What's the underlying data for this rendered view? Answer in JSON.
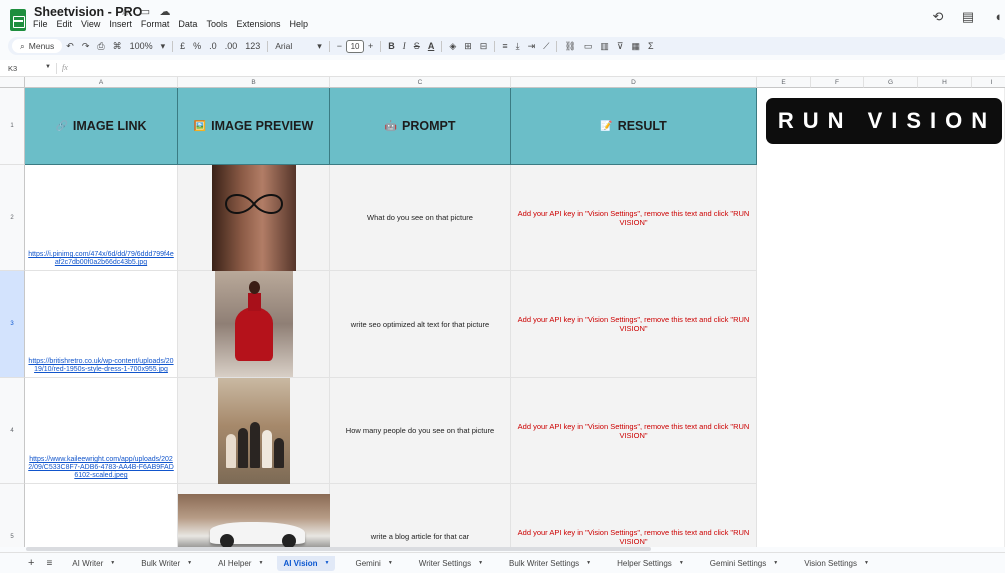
{
  "app": {
    "title": "Sheetvision - PRO",
    "menus": [
      "File",
      "Edit",
      "View",
      "Insert",
      "Format",
      "Data",
      "Tools",
      "Extensions",
      "Help"
    ]
  },
  "toolbar": {
    "menus_label": "Menus",
    "zoom": "100%",
    "currency": "£",
    "percent": "%",
    "dec_decrease": ".0",
    "dec_increase": ".00",
    "number_format": "123",
    "font": "Arial",
    "font_size": "10",
    "bold": "B",
    "italic": "I",
    "strike": "S",
    "text_color": "A",
    "sum": "Σ"
  },
  "formula_bar": {
    "cell_ref": "K3",
    "fx": "fx",
    "value": ""
  },
  "columns": [
    "A",
    "B",
    "C",
    "D",
    "E",
    "F",
    "G",
    "H",
    "I"
  ],
  "rows": [
    "1",
    "2",
    "3",
    "4",
    "5"
  ],
  "headers": {
    "link": "IMAGE LINK",
    "preview": "IMAGE PREVIEW",
    "prompt": "PROMPT",
    "result": "RESULT"
  },
  "header_icons": {
    "link": "🔗",
    "preview": "🖼️",
    "prompt": "🤖",
    "result": "📝"
  },
  "data_rows": [
    {
      "link": "https://i.pinimg.com/474x/6d/dd/79/6ddd799f4eaf2c7db00f0a2b66dc43b5.jpg",
      "prompt": "What do you see on that picture",
      "result": "Add your API key in \"Vision Settings\", remove this text and click \"RUN VISION\""
    },
    {
      "link": "https://britishretro.co.uk/wp-content/uploads/2019/10/red-1950s-style-dress-1-700x955.jpg",
      "prompt": "write seo optimized alt text for that picture",
      "result": "Add your API key in \"Vision Settings\", remove this text and click \"RUN VISION\""
    },
    {
      "link": "https://www.kaileewright.com/app/uploads/2022/09/C533C8F7-ADB6-4783-AA4B-F6AB9FAD6102-scaled.jpeg",
      "prompt": "How many people do you see on that picture",
      "result": "Add your API key in \"Vision Settings\", remove this text and click \"RUN VISION\""
    },
    {
      "link": "",
      "prompt": "write a blog article for that car",
      "result": "Add your API key in \"Vision Settings\", remove this text and click \"RUN VISION\""
    }
  ],
  "run_button": "RUN VISION",
  "sheet_tabs": [
    "AI Writer",
    "Bulk Writer",
    "AI Helper",
    "AI Vision",
    "Gemini",
    "Writer Settings",
    "Bulk Writer Settings",
    "Helper Settings",
    "Gemini Settings",
    "Vision Settings"
  ],
  "active_tab": "AI Vision",
  "colors": {
    "header_bg": "#6bbec8",
    "result_text": "#cc0000",
    "link_text": "#1155cc",
    "active_tab": "#0b57d0"
  }
}
